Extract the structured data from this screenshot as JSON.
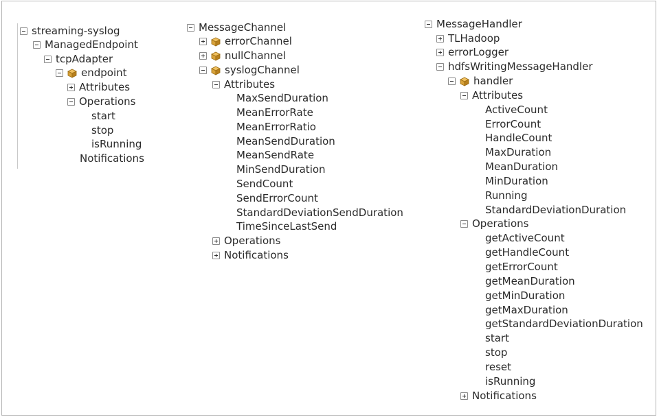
{
  "col1": {
    "root": "streaming-syslog",
    "managed_endpoint": "ManagedEndpoint",
    "tcp_adapter": "tcpAdapter",
    "endpoint": "endpoint",
    "attributes": "Attributes",
    "operations": "Operations",
    "ops": [
      "start",
      "stop",
      "isRunning"
    ],
    "notifications": "Notifications"
  },
  "col2": {
    "root": "MessageChannel",
    "error_channel": "errorChannel",
    "null_channel": "nullChannel",
    "syslog_channel": "syslogChannel",
    "attributes": "Attributes",
    "attrs": [
      "MaxSendDuration",
      "MeanErrorRate",
      "MeanErrorRatio",
      "MeanSendDuration",
      "MeanSendRate",
      "MinSendDuration",
      "SendCount",
      "SendErrorCount",
      "StandardDeviationSendDuration",
      "TimeSinceLastSend"
    ],
    "operations": "Operations",
    "notifications": "Notifications"
  },
  "col3": {
    "root": "MessageHandler",
    "tl_hadoop": "TLHadoop",
    "error_logger": "errorLogger",
    "hdfs_handler": "hdfsWritingMessageHandler",
    "handler": "handler",
    "attributes": "Attributes",
    "attrs": [
      "ActiveCount",
      "ErrorCount",
      "HandleCount",
      "MaxDuration",
      "MeanDuration",
      "MinDuration",
      "Running",
      "StandardDeviationDuration"
    ],
    "operations": "Operations",
    "ops": [
      "getActiveCount",
      "getHandleCount",
      "getErrorCount",
      "getMeanDuration",
      "getMinDuration",
      "getMaxDuration",
      "getStandardDeviationDuration",
      "start",
      "stop",
      "reset",
      "isRunning"
    ],
    "notifications": "Notifications"
  },
  "icons": {
    "expand": "plus-box-icon",
    "collapse": "minus-box-icon",
    "mbean": "mbean-cube-icon"
  },
  "colors": {
    "text": "#2b2b2b",
    "bean": "#d8a23a",
    "border": "#b5b5b5"
  }
}
